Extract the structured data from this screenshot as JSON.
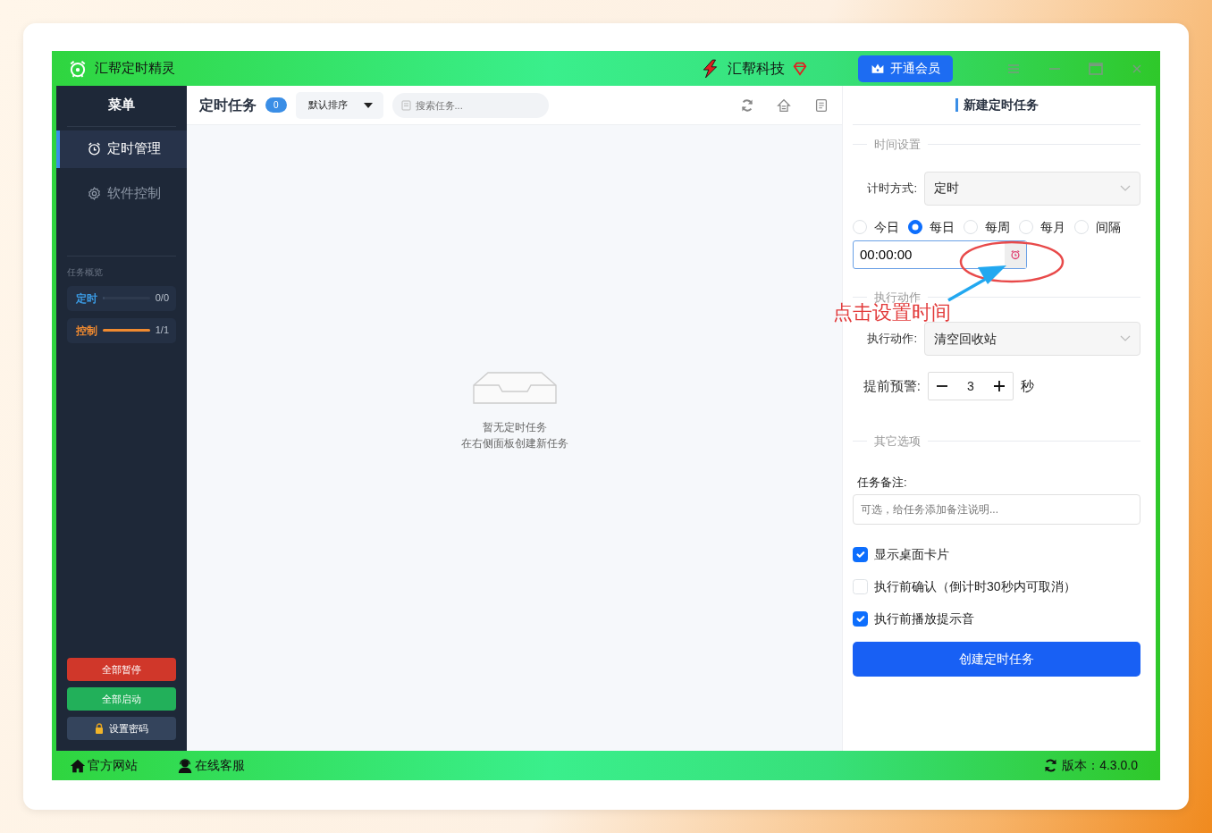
{
  "window": {
    "title": "汇帮定时精灵",
    "brand": "汇帮科技",
    "vip_button": "开通会员"
  },
  "sidebar": {
    "title": "菜单",
    "items": [
      {
        "label": "定时管理",
        "kind": "clock",
        "selected": true
      },
      {
        "label": "软件控制",
        "kind": "gear",
        "selected": false
      }
    ],
    "overview": {
      "title": "任务概览",
      "stats": [
        {
          "label": "定时",
          "reading": "0/0",
          "level": 0,
          "color": "#3b9ce6"
        },
        {
          "label": "控制",
          "reading": "1/1",
          "level": 1,
          "color": "#f08a30"
        }
      ]
    },
    "buttons": [
      {
        "label": "全部暂停",
        "kind": "danger"
      },
      {
        "label": "全部启动",
        "kind": "success"
      },
      {
        "label": "设置密码",
        "kind": "lock"
      }
    ]
  },
  "tasks": {
    "title": "定时任务",
    "count": "0",
    "sort": "默认排序",
    "search": {
      "placeholder": "搜索任务..."
    },
    "empty": [
      "暂无定时任务",
      "在右侧面板创建新任务"
    ]
  },
  "form": {
    "title": "新建定时任务",
    "time_section": "时间设置",
    "mode_label": "计时方式:",
    "mode_value": "定时",
    "repeat": [
      {
        "label": "今日",
        "selected": false
      },
      {
        "label": "每日",
        "selected": true
      },
      {
        "label": "每周",
        "selected": false
      },
      {
        "label": "每月",
        "selected": false
      },
      {
        "label": "间隔",
        "selected": false
      }
    ],
    "time_value": "00:00:00",
    "action_section": "执行动作",
    "action_label": "执行动作:",
    "action_value": "清空回收站",
    "warn_label": "提前预警:",
    "warn_value": "3",
    "warn_unit": "秒",
    "other_section": "其它选项",
    "note_label": "任务备注:",
    "note_placeholder": "可选，给任务添加备注说明...",
    "options": [
      {
        "label": "显示桌面卡片",
        "checked": true
      },
      {
        "label": "执行前确认（倒计时30秒内可取消）",
        "checked": false
      },
      {
        "label": "执行前播放提示音",
        "checked": true
      }
    ],
    "submit": "创建定时任务"
  },
  "footer": {
    "links": [
      {
        "label": "官方网站",
        "kind": "home"
      },
      {
        "label": "在线客服",
        "kind": "support"
      }
    ],
    "version": "版本：4.3.0.0"
  },
  "annotation": {
    "text": "点击设置时间"
  }
}
